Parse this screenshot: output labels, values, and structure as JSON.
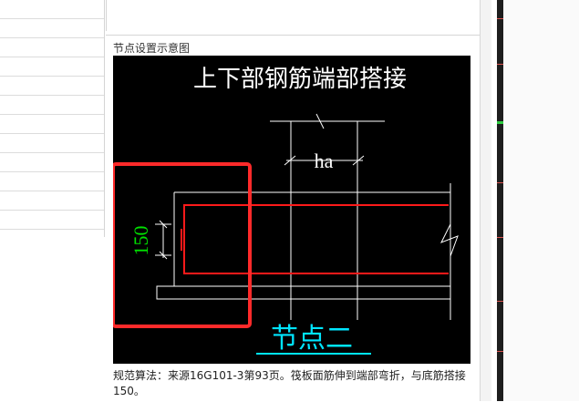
{
  "panel": {
    "title": "节点设置示意图"
  },
  "diagram": {
    "title": "上下部钢筋端部搭接",
    "dimension_ha": "ha",
    "dimension_150": "150",
    "node_label": "节点二",
    "colors": {
      "background": "#000000",
      "lines": "#ffffff",
      "rebar": "#ff1a1a",
      "dimension_text": "#00e000",
      "node_label": "#00e5ff",
      "highlight_box": "#ff2a2a"
    }
  },
  "note": {
    "text": "规范算法：来源16G101-3第93页。筏板面筋伸到端部弯折，与底筋搭接150。"
  },
  "colors": {
    "ruler_green": "#2ecc40",
    "ruler_red": "#d9534f"
  }
}
